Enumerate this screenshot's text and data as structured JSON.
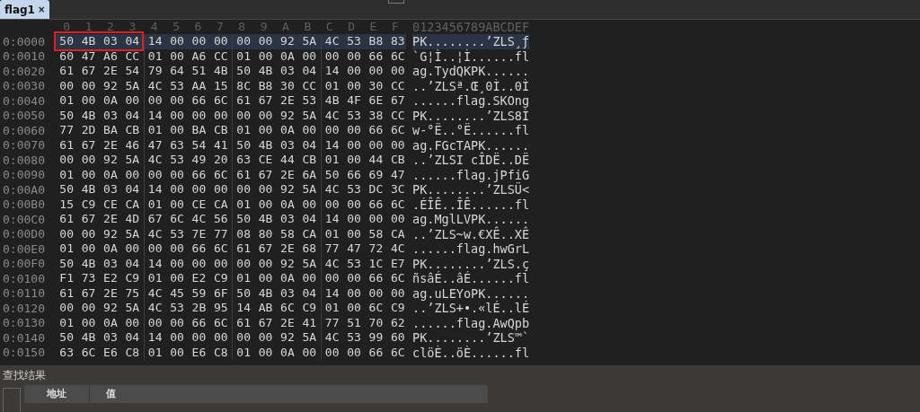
{
  "tabs": [
    {
      "label": "flag1",
      "close": "×",
      "selected": true
    }
  ],
  "columns": [
    "0",
    "1",
    "2",
    "3",
    "4",
    "5",
    "6",
    "7",
    "8",
    "9",
    "A",
    "B",
    "C",
    "D",
    "E",
    "F"
  ],
  "ascii_header": "0123456789ABCDEF",
  "rows": [
    {
      "offset": "0:0000",
      "bytes": [
        "50",
        "4B",
        "03",
        "04",
        "14",
        "00",
        "00",
        "00",
        "00",
        "00",
        "92",
        "5A",
        "4C",
        "53",
        "B8",
        "83"
      ],
      "ascii": "PK........’ZLS¸ƒ",
      "selected": true,
      "marked": true
    },
    {
      "offset": "0:0010",
      "bytes": [
        "60",
        "47",
        "A6",
        "CC",
        "01",
        "00",
        "A6",
        "CC",
        "01",
        "00",
        "0A",
        "00",
        "00",
        "00",
        "66",
        "6C"
      ],
      "ascii": "`G¦Ì..¦Ì......fl",
      "selected": false,
      "marked": false
    },
    {
      "offset": "0:0020",
      "bytes": [
        "61",
        "67",
        "2E",
        "54",
        "79",
        "64",
        "51",
        "4B",
        "50",
        "4B",
        "03",
        "04",
        "14",
        "00",
        "00",
        "00"
      ],
      "ascii": "ag.TydQKPK......",
      "selected": false,
      "marked": false
    },
    {
      "offset": "0:0030",
      "bytes": [
        "00",
        "00",
        "92",
        "5A",
        "4C",
        "53",
        "AA",
        "15",
        "8C",
        "B8",
        "30",
        "CC",
        "01",
        "00",
        "30",
        "CC"
      ],
      "ascii": "..’ZLSª.Œ¸0Ì..0Ì",
      "selected": false,
      "marked": false
    },
    {
      "offset": "0:0040",
      "bytes": [
        "01",
        "00",
        "0A",
        "00",
        "00",
        "00",
        "66",
        "6C",
        "61",
        "67",
        "2E",
        "53",
        "4B",
        "4F",
        "6E",
        "67"
      ],
      "ascii": "......flag.SKOng",
      "selected": false,
      "marked": false
    },
    {
      "offset": "0:0050",
      "bytes": [
        "50",
        "4B",
        "03",
        "04",
        "14",
        "00",
        "00",
        "00",
        "00",
        "00",
        "92",
        "5A",
        "4C",
        "53",
        "38",
        "CC"
      ],
      "ascii": "PK........’ZLS8Ì",
      "selected": false,
      "marked": false
    },
    {
      "offset": "0:0060",
      "bytes": [
        "77",
        "2D",
        "BA",
        "CB",
        "01",
        "00",
        "BA",
        "CB",
        "01",
        "00",
        "0A",
        "00",
        "00",
        "00",
        "66",
        "6C"
      ],
      "ascii": "w-°Ë..°Ë......fl",
      "selected": false,
      "marked": false
    },
    {
      "offset": "0:0070",
      "bytes": [
        "61",
        "67",
        "2E",
        "46",
        "47",
        "63",
        "54",
        "41",
        "50",
        "4B",
        "03",
        "04",
        "14",
        "00",
        "00",
        "00"
      ],
      "ascii": "ag.FGcTAPK......",
      "selected": false,
      "marked": false
    },
    {
      "offset": "0:0080",
      "bytes": [
        "00",
        "00",
        "92",
        "5A",
        "4C",
        "53",
        "49",
        "20",
        "63",
        "CE",
        "44",
        "CB",
        "01",
        "00",
        "44",
        "CB"
      ],
      "ascii": "..’ZLSI cÎDË..DË",
      "selected": false,
      "marked": false
    },
    {
      "offset": "0:0090",
      "bytes": [
        "01",
        "00",
        "0A",
        "00",
        "00",
        "00",
        "66",
        "6C",
        "61",
        "67",
        "2E",
        "6A",
        "50",
        "66",
        "69",
        "47"
      ],
      "ascii": "......flag.jPfiG",
      "selected": false,
      "marked": false
    },
    {
      "offset": "0:00A0",
      "bytes": [
        "50",
        "4B",
        "03",
        "04",
        "14",
        "00",
        "00",
        "00",
        "00",
        "00",
        "92",
        "5A",
        "4C",
        "53",
        "DC",
        "3C"
      ],
      "ascii": "PK........’ZLSÜ<",
      "selected": false,
      "marked": false
    },
    {
      "offset": "0:00B0",
      "bytes": [
        "15",
        "C9",
        "CE",
        "CA",
        "01",
        "00",
        "CE",
        "CA",
        "01",
        "00",
        "0A",
        "00",
        "00",
        "00",
        "66",
        "6C"
      ],
      "ascii": ".ÉÎÊ..ÎÊ......fl",
      "selected": false,
      "marked": false
    },
    {
      "offset": "0:00C0",
      "bytes": [
        "61",
        "67",
        "2E",
        "4D",
        "67",
        "6C",
        "4C",
        "56",
        "50",
        "4B",
        "03",
        "04",
        "14",
        "00",
        "00",
        "00"
      ],
      "ascii": "ag.MglLVPK......",
      "selected": false,
      "marked": false
    },
    {
      "offset": "0:00D0",
      "bytes": [
        "00",
        "00",
        "92",
        "5A",
        "4C",
        "53",
        "7E",
        "77",
        "08",
        "80",
        "58",
        "CA",
        "01",
        "00",
        "58",
        "CA"
      ],
      "ascii": "..’ZLS~w.€XÊ..XÊ",
      "selected": false,
      "marked": false
    },
    {
      "offset": "0:00E0",
      "bytes": [
        "01",
        "00",
        "0A",
        "00",
        "00",
        "00",
        "66",
        "6C",
        "61",
        "67",
        "2E",
        "68",
        "77",
        "47",
        "72",
        "4C"
      ],
      "ascii": "......flag.hwGrL",
      "selected": false,
      "marked": false
    },
    {
      "offset": "0:00F0",
      "bytes": [
        "50",
        "4B",
        "03",
        "04",
        "14",
        "00",
        "00",
        "00",
        "00",
        "00",
        "92",
        "5A",
        "4C",
        "53",
        "1C",
        "E7"
      ],
      "ascii": "PK........’ZLS.ç",
      "selected": false,
      "marked": false
    },
    {
      "offset": "0:0100",
      "bytes": [
        "F1",
        "73",
        "E2",
        "C9",
        "01",
        "00",
        "E2",
        "C9",
        "01",
        "00",
        "0A",
        "00",
        "00",
        "00",
        "66",
        "6C"
      ],
      "ascii": "ñsâÉ..âÉ......fl",
      "selected": false,
      "marked": false
    },
    {
      "offset": "0:0110",
      "bytes": [
        "61",
        "67",
        "2E",
        "75",
        "4C",
        "45",
        "59",
        "6F",
        "50",
        "4B",
        "03",
        "04",
        "14",
        "00",
        "00",
        "00"
      ],
      "ascii": "ag.uLEYoPK......",
      "selected": false,
      "marked": false
    },
    {
      "offset": "0:0120",
      "bytes": [
        "00",
        "00",
        "92",
        "5A",
        "4C",
        "53",
        "2B",
        "95",
        "14",
        "AB",
        "6C",
        "C9",
        "01",
        "00",
        "6C",
        "C9"
      ],
      "ascii": "..’ZLS+•.«lÉ..lÉ",
      "selected": false,
      "marked": false
    },
    {
      "offset": "0:0130",
      "bytes": [
        "01",
        "00",
        "0A",
        "00",
        "00",
        "00",
        "66",
        "6C",
        "61",
        "67",
        "2E",
        "41",
        "77",
        "51",
        "70",
        "62"
      ],
      "ascii": "......flag.AwQpb",
      "selected": false,
      "marked": false
    },
    {
      "offset": "0:0140",
      "bytes": [
        "50",
        "4B",
        "03",
        "04",
        "14",
        "00",
        "00",
        "00",
        "00",
        "00",
        "92",
        "5A",
        "4C",
        "53",
        "99",
        "60"
      ],
      "ascii": "PK........’ZLS™`",
      "selected": false,
      "marked": false
    },
    {
      "offset": "0:0150",
      "bytes": [
        "63",
        "6C",
        "E6",
        "C8",
        "01",
        "00",
        "E6",
        "C8",
        "01",
        "00",
        "0A",
        "00",
        "00",
        "00",
        "66",
        "6C"
      ],
      "ascii": "clöÈ..öÈ......fl",
      "selected": false,
      "marked": false
    }
  ],
  "results_panel": {
    "title": "查找结果",
    "columns": [
      "地址",
      "值"
    ]
  }
}
